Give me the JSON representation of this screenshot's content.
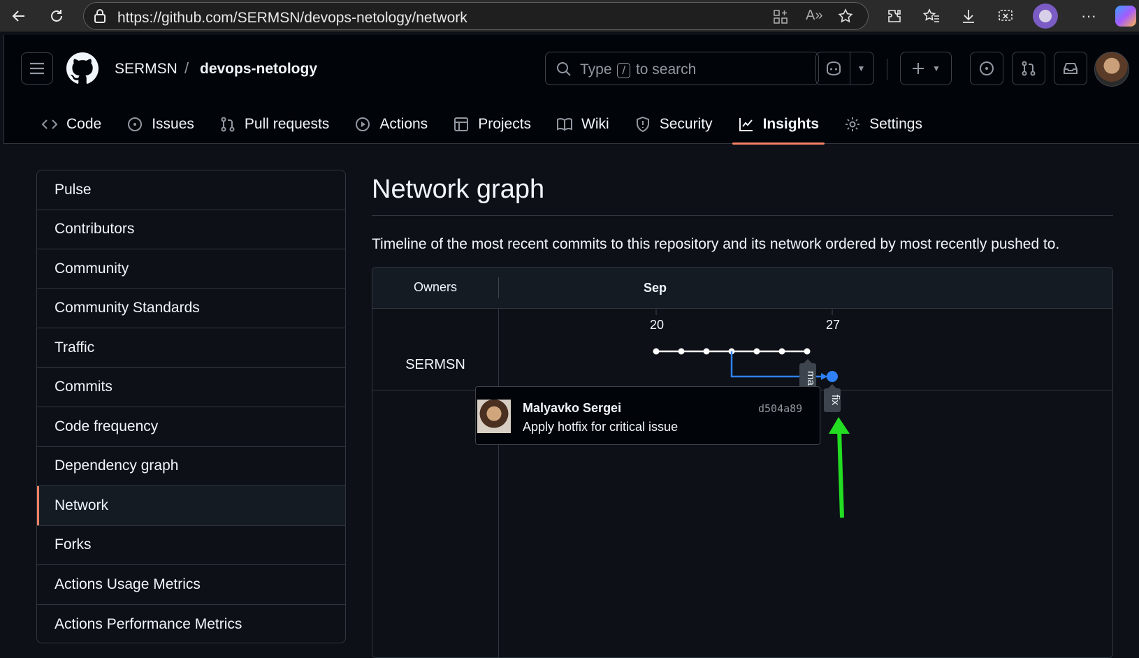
{
  "browser": {
    "url": "https://github.com/SERMSN/devops-netology/network"
  },
  "header": {
    "owner": "SERMSN",
    "separator": "/",
    "repo": "devops-netology",
    "search_prefix": "Type",
    "search_key": "/",
    "search_suffix": "to search"
  },
  "nav": {
    "tabs": [
      {
        "label": "Code",
        "icon": "code-icon"
      },
      {
        "label": "Issues",
        "icon": "issue-icon"
      },
      {
        "label": "Pull requests",
        "icon": "pull-request-icon"
      },
      {
        "label": "Actions",
        "icon": "play-icon"
      },
      {
        "label": "Projects",
        "icon": "table-icon"
      },
      {
        "label": "Wiki",
        "icon": "book-icon"
      },
      {
        "label": "Security",
        "icon": "shield-icon"
      },
      {
        "label": "Insights",
        "icon": "graph-icon"
      },
      {
        "label": "Settings",
        "icon": "gear-icon"
      }
    ],
    "active": "Insights"
  },
  "sidebar": {
    "items": [
      {
        "label": "Pulse"
      },
      {
        "label": "Contributors"
      },
      {
        "label": "Community"
      },
      {
        "label": "Community Standards"
      },
      {
        "label": "Traffic"
      },
      {
        "label": "Commits"
      },
      {
        "label": "Code frequency"
      },
      {
        "label": "Dependency graph"
      },
      {
        "label": "Network"
      },
      {
        "label": "Forks"
      },
      {
        "label": "Actions Usage Metrics"
      },
      {
        "label": "Actions Performance Metrics"
      }
    ],
    "selected": "Network"
  },
  "main": {
    "title": "Network graph",
    "description": "Timeline of the most recent commits to this repository and its network ordered by most recently pushed to."
  },
  "graph": {
    "owners_label": "Owners",
    "month": "Sep",
    "days": [
      "20",
      "27"
    ],
    "owner": "SERMSN",
    "branch_labels": [
      "ma",
      "fix"
    ],
    "colors": {
      "main": "#ffffff",
      "branch": "#2f81f7",
      "arrow": "#22dd22"
    }
  },
  "commit": {
    "author": "Malyavko Sergei",
    "sha": "d504a89",
    "message": "Apply hotfix for critical issue"
  }
}
